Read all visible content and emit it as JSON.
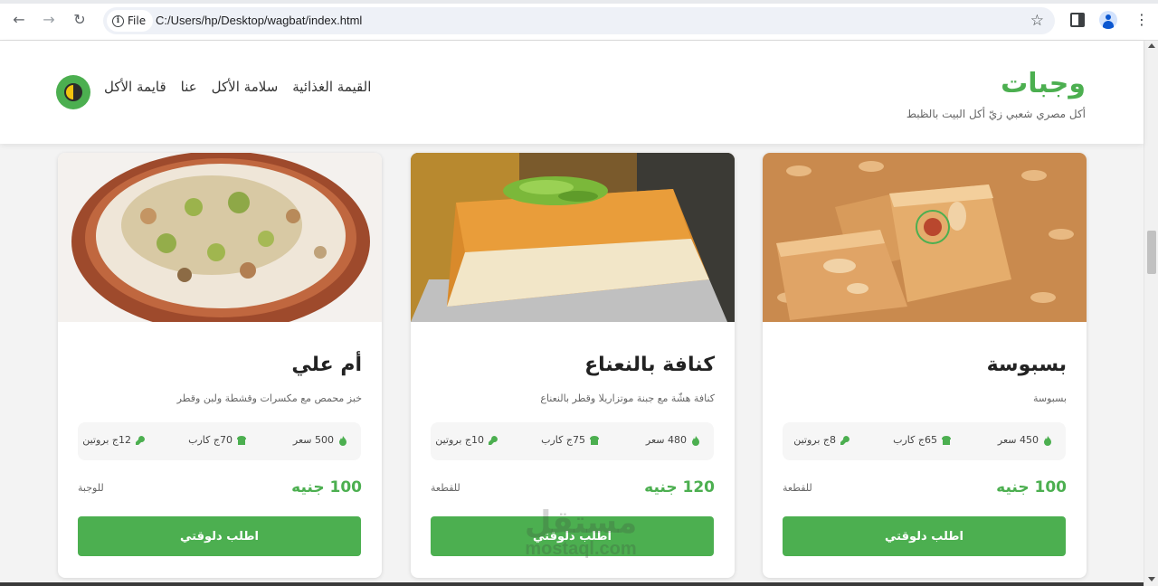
{
  "browser": {
    "site_chip": "File",
    "url": "C:/Users/hp/Desktop/wagbat/index.html",
    "icons": [
      "back-arrow-icon",
      "forward-arrow-icon",
      "reload-icon",
      "info-icon",
      "star-icon",
      "side-panel-icon",
      "profile-icon",
      "menu-dots-icon"
    ]
  },
  "header": {
    "title": "وجبات",
    "subtitle": "أكل مصري شعبي زيّ أكل البيت بالظبط",
    "nav": [
      "قايمة الأكل",
      "عنا",
      "سلامة الأكل",
      "القيمة الغذائية"
    ]
  },
  "colors": {
    "accent": "#4caf50",
    "header_bg": "#ffffff",
    "page_bg": "#f3f3f3"
  },
  "cards": [
    {
      "title": "أم علي",
      "description": "خبز محمص مع مكسرات وقشطة ولبن وقطر",
      "calories": "500 سعر",
      "carbs": "70ج كارب",
      "protein": "12ج بروتين",
      "price": "100 جنيه",
      "unit": "للوجبة",
      "button": "اطلب دلوقتي",
      "image": "om-ali-photo"
    },
    {
      "title": "كنافة بالنعناع",
      "description": "كنافة هشّة مع جبنة موتزاريلا وقطر بالنعناع",
      "calories": "480 سعر",
      "carbs": "75ج كارب",
      "protein": "10ج بروتين",
      "price": "120 جنيه",
      "unit": "للقطعة",
      "button": "اطلب دلوقتي",
      "image": "kunafa-photo"
    },
    {
      "title": "بسبوسة",
      "description": "بسبوسة",
      "calories": "450 سعر",
      "carbs": "65ج كارب",
      "protein": "8ج بروتين",
      "price": "100 جنيه",
      "unit": "للقطعة",
      "button": "اطلب دلوقتي",
      "image": "basbousa-photo"
    }
  ],
  "watermark": {
    "arabic": "مستقل",
    "latin": "mostaql.com"
  }
}
